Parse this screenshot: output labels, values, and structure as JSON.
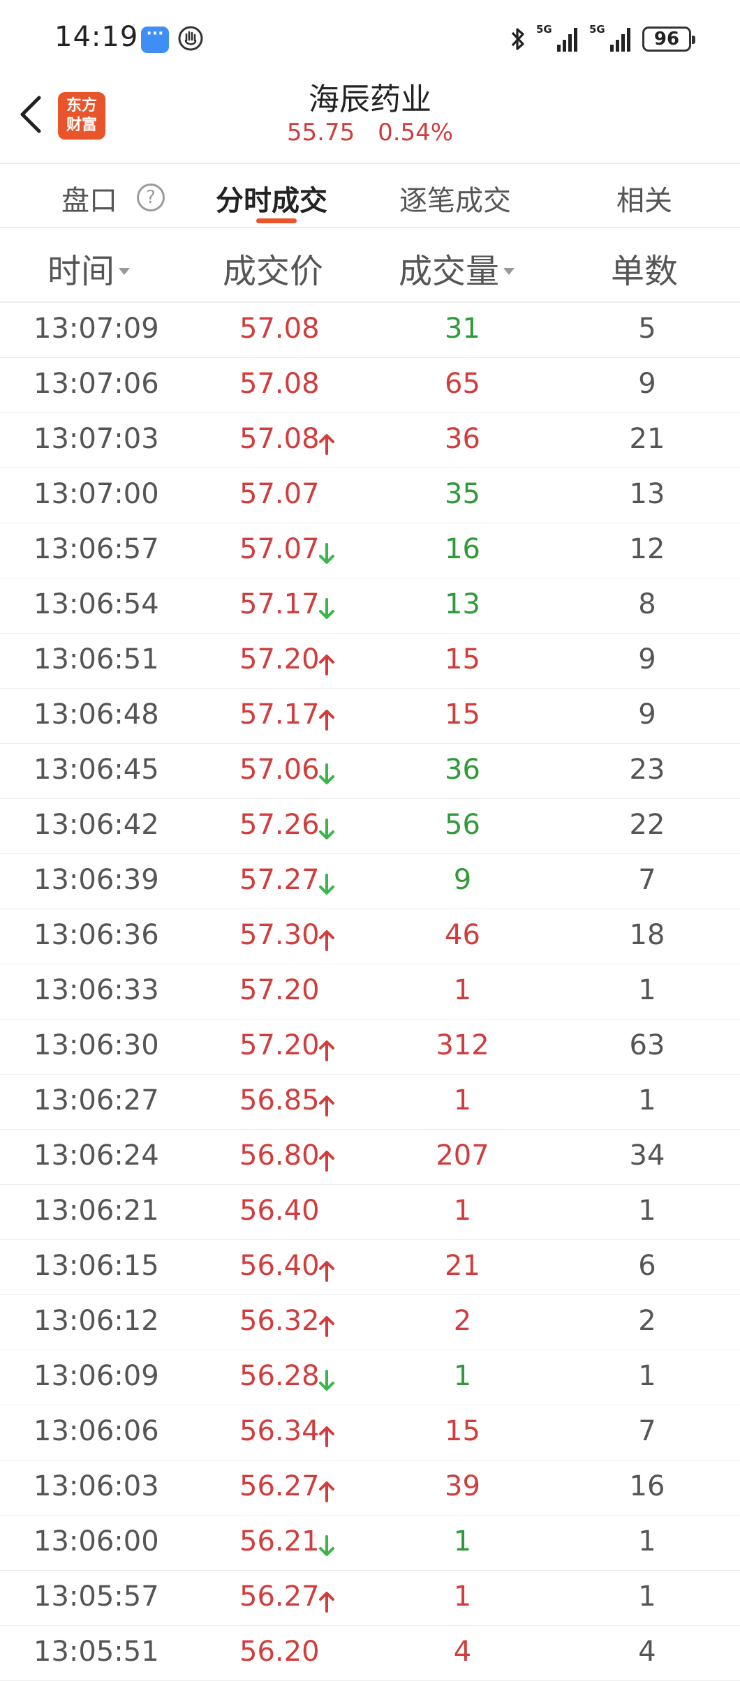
{
  "status_bar": {
    "time": "14:19",
    "signal1_label": "5G",
    "signal2_label": "5G",
    "battery": "96"
  },
  "header": {
    "logo_text_top": "东方",
    "logo_text_bottom": "财富",
    "stock_name": "海辰药业",
    "price": "55.75",
    "change_pct": "0.54%"
  },
  "tabs": [
    {
      "label": "盘口",
      "active": false
    },
    {
      "label": "分时成交",
      "active": true
    },
    {
      "label": "逐笔成交",
      "active": false
    },
    {
      "label": "相关",
      "active": false
    }
  ],
  "columns": {
    "time": "时间",
    "price": "成交价",
    "volume": "成交量",
    "count": "单数"
  },
  "colors": {
    "up": "#d13d3d",
    "down": "#2f9a3a",
    "accent": "#e8552b"
  },
  "rows": [
    {
      "time": "13:07:09",
      "price": "57.08",
      "arrow": "",
      "volume": "31",
      "vol_color": "green",
      "count": "5"
    },
    {
      "time": "13:07:06",
      "price": "57.08",
      "arrow": "",
      "volume": "65",
      "vol_color": "red",
      "count": "9"
    },
    {
      "time": "13:07:03",
      "price": "57.08",
      "arrow": "up",
      "volume": "36",
      "vol_color": "red",
      "count": "21"
    },
    {
      "time": "13:07:00",
      "price": "57.07",
      "arrow": "",
      "volume": "35",
      "vol_color": "green",
      "count": "13"
    },
    {
      "time": "13:06:57",
      "price": "57.07",
      "arrow": "down",
      "volume": "16",
      "vol_color": "green",
      "count": "12"
    },
    {
      "time": "13:06:54",
      "price": "57.17",
      "arrow": "down",
      "volume": "13",
      "vol_color": "green",
      "count": "8"
    },
    {
      "time": "13:06:51",
      "price": "57.20",
      "arrow": "up",
      "volume": "15",
      "vol_color": "red",
      "count": "9"
    },
    {
      "time": "13:06:48",
      "price": "57.17",
      "arrow": "up",
      "volume": "15",
      "vol_color": "red",
      "count": "9"
    },
    {
      "time": "13:06:45",
      "price": "57.06",
      "arrow": "down",
      "volume": "36",
      "vol_color": "green",
      "count": "23"
    },
    {
      "time": "13:06:42",
      "price": "57.26",
      "arrow": "down",
      "volume": "56",
      "vol_color": "green",
      "count": "22"
    },
    {
      "time": "13:06:39",
      "price": "57.27",
      "arrow": "down",
      "volume": "9",
      "vol_color": "green",
      "count": "7"
    },
    {
      "time": "13:06:36",
      "price": "57.30",
      "arrow": "up",
      "volume": "46",
      "vol_color": "red",
      "count": "18"
    },
    {
      "time": "13:06:33",
      "price": "57.20",
      "arrow": "",
      "volume": "1",
      "vol_color": "red",
      "count": "1"
    },
    {
      "time": "13:06:30",
      "price": "57.20",
      "arrow": "up",
      "volume": "312",
      "vol_color": "red",
      "count": "63"
    },
    {
      "time": "13:06:27",
      "price": "56.85",
      "arrow": "up",
      "volume": "1",
      "vol_color": "red",
      "count": "1"
    },
    {
      "time": "13:06:24",
      "price": "56.80",
      "arrow": "up",
      "volume": "207",
      "vol_color": "red",
      "count": "34"
    },
    {
      "time": "13:06:21",
      "price": "56.40",
      "arrow": "",
      "volume": "1",
      "vol_color": "red",
      "count": "1"
    },
    {
      "time": "13:06:15",
      "price": "56.40",
      "arrow": "up",
      "volume": "21",
      "vol_color": "red",
      "count": "6"
    },
    {
      "time": "13:06:12",
      "price": "56.32",
      "arrow": "up",
      "volume": "2",
      "vol_color": "red",
      "count": "2"
    },
    {
      "time": "13:06:09",
      "price": "56.28",
      "arrow": "down",
      "volume": "1",
      "vol_color": "green",
      "count": "1"
    },
    {
      "time": "13:06:06",
      "price": "56.34",
      "arrow": "up",
      "volume": "15",
      "vol_color": "red",
      "count": "7"
    },
    {
      "time": "13:06:03",
      "price": "56.27",
      "arrow": "up",
      "volume": "39",
      "vol_color": "red",
      "count": "16"
    },
    {
      "time": "13:06:00",
      "price": "56.21",
      "arrow": "down",
      "volume": "1",
      "vol_color": "green",
      "count": "1"
    },
    {
      "time": "13:05:57",
      "price": "56.27",
      "arrow": "up",
      "volume": "1",
      "vol_color": "red",
      "count": "1"
    },
    {
      "time": "13:05:51",
      "price": "56.20",
      "arrow": "",
      "volume": "4",
      "vol_color": "red",
      "count": "4"
    }
  ]
}
